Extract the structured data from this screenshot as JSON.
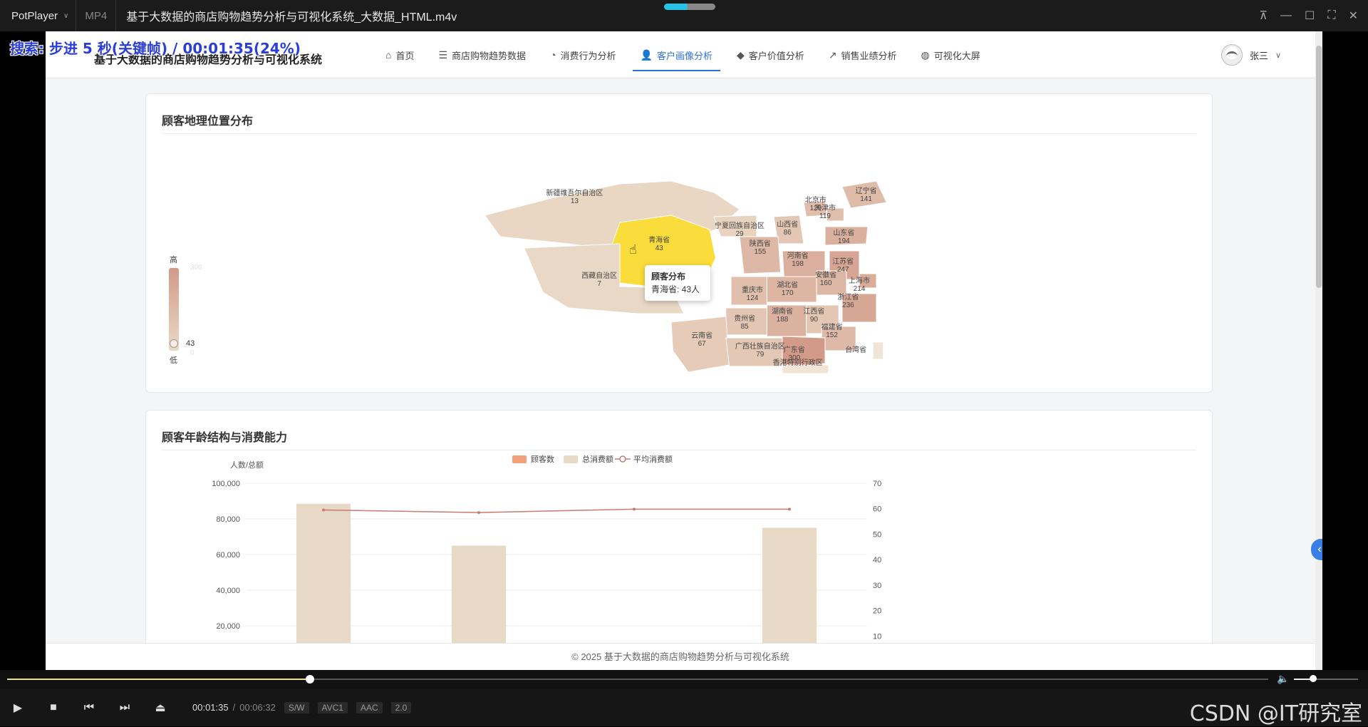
{
  "player": {
    "brand": "PotPlayer",
    "format": "MP4",
    "file_title": "基于大数据的商店购物趋势分析与可视化系统_大数据_HTML.m4v",
    "osd_prefix": "搜索:",
    "osd_text": "步进 5 秒(关键帧) / 00:01:35(24%)",
    "time_current": "00:01:35",
    "time_separator": "/",
    "time_total": "00:06:32",
    "progress_fraction": 0.24,
    "volume_fraction": 0.3,
    "tags": [
      "S/W",
      "AVC1",
      "AAC",
      "2.0"
    ],
    "watermark": "CSDN @IT研究室"
  },
  "site": {
    "title": "基于大数据的商店购物趋势分析与可视化系统",
    "nav": [
      {
        "label": "首页",
        "icon": "home-icon",
        "active": false
      },
      {
        "label": "商店购物趋势数据",
        "icon": "database-icon",
        "active": false
      },
      {
        "label": "消费行为分析",
        "icon": "pie-chart-icon",
        "active": false
      },
      {
        "label": "客户画像分析",
        "icon": "user-icon",
        "active": true
      },
      {
        "label": "客户价值分析",
        "icon": "diamond-icon",
        "active": false
      },
      {
        "label": "销售业绩分析",
        "icon": "line-chart-icon",
        "active": false
      },
      {
        "label": "可视化大屏",
        "icon": "globe-icon",
        "active": false
      }
    ],
    "user_name": "张三",
    "footer": "© 2025 基于大数据的商店购物趋势分析与可视化系统"
  },
  "geo_card": {
    "title": "顾客地理位置分布",
    "visual_map": {
      "high_label": "高",
      "low_label": "低",
      "max": "300",
      "min": "0",
      "current": "43",
      "color_high": "#d29a88",
      "color_low": "#ead9c6"
    },
    "highlight_color": "#fadc3a",
    "tooltip": {
      "title": "顾客分布",
      "line": "青海省: 43人"
    },
    "regions": [
      {
        "name": "新疆维吾尔自治区",
        "value": "13"
      },
      {
        "name": "青海省",
        "value": "43"
      },
      {
        "name": "西藏自治区",
        "value": "7"
      },
      {
        "name": "宁夏回族自治区",
        "value": "29"
      },
      {
        "name": "山西省",
        "value": "86"
      },
      {
        "name": "北京市",
        "value": "129"
      },
      {
        "name": "天津市",
        "value": "119"
      },
      {
        "name": "辽宁省",
        "value": "141"
      },
      {
        "name": "山东省",
        "value": "194"
      },
      {
        "name": "陕西省",
        "value": "155"
      },
      {
        "name": "河南省",
        "value": "198"
      },
      {
        "name": "江苏省",
        "value": "247"
      },
      {
        "name": "安徽省",
        "value": "160"
      },
      {
        "name": "上海市",
        "value": "214"
      },
      {
        "name": "湖北省",
        "value": "170"
      },
      {
        "name": "重庆市",
        "value": "124"
      },
      {
        "name": "浙江省",
        "value": "236"
      },
      {
        "name": "湖南省",
        "value": "188"
      },
      {
        "name": "江西省",
        "value": "90"
      },
      {
        "name": "贵州省",
        "value": "85"
      },
      {
        "name": "福建省",
        "value": "152"
      },
      {
        "name": "云南省",
        "value": "67"
      },
      {
        "name": "广西壮族自治区",
        "value": "79"
      },
      {
        "name": "广东省",
        "value": "300"
      },
      {
        "name": "台湾省",
        "value": ""
      },
      {
        "name": "香港特别行政区",
        "value": ""
      }
    ]
  },
  "age_card": {
    "title": "顾客年龄结构与消费能力",
    "chart_data": {
      "type": "bar",
      "legend": [
        {
          "name": "顾客数",
          "color": "#f4a07a"
        },
        {
          "name": "总消费额",
          "color": "#e8d8c6"
        },
        {
          "name": "平均消费额",
          "color": "#c97b72"
        }
      ],
      "y_left_label": "人数/总额",
      "y_left_ticks": [
        "100,000",
        "80,000",
        "60,000",
        "40,000",
        "20,000"
      ],
      "y_right_ticks": [
        "70",
        "60",
        "50",
        "40",
        "30",
        "20",
        "10"
      ],
      "ylim_left": [
        0,
        100000
      ],
      "ylim_right": [
        0,
        70
      ],
      "series": [
        {
          "name": "总消费额",
          "values": [
            88500,
            65000,
            null,
            75000
          ]
        },
        {
          "name": "平均消费额",
          "values": [
            59.5,
            58.5,
            59.8,
            59.8
          ]
        }
      ]
    }
  }
}
